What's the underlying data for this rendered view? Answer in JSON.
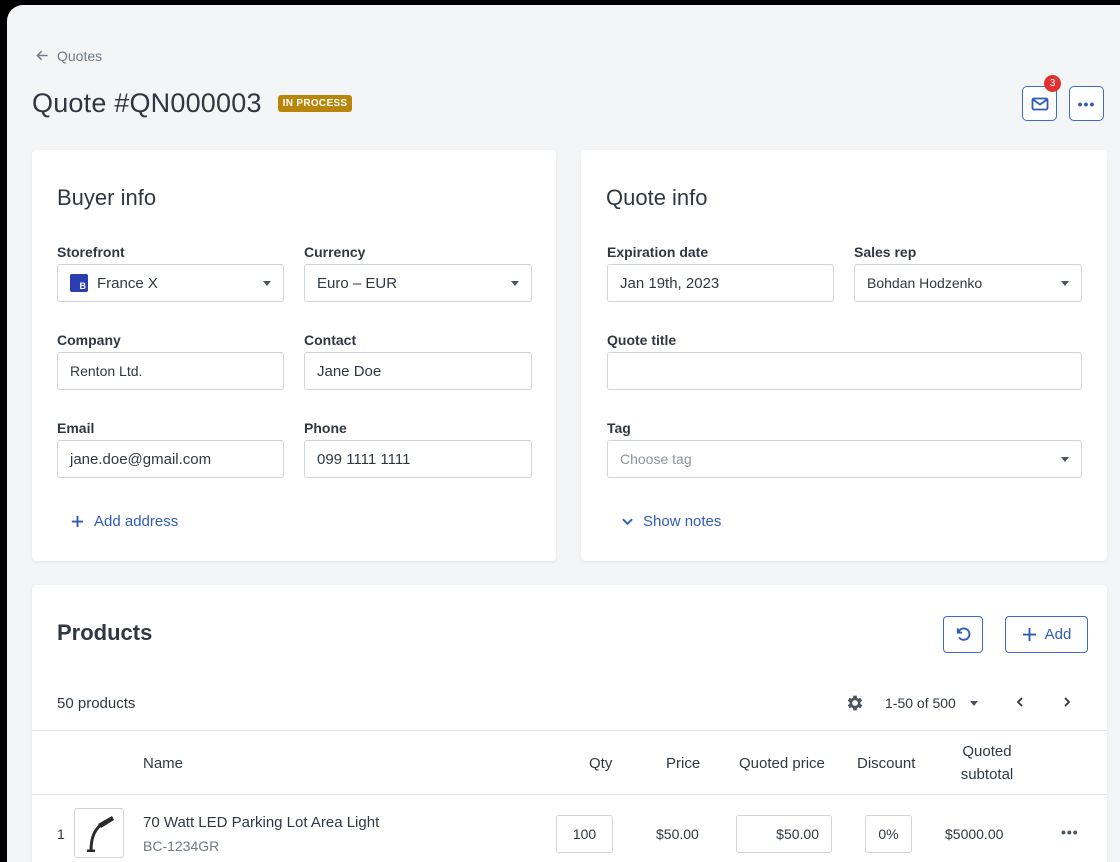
{
  "breadcrumb": {
    "back_label": "Quotes"
  },
  "header": {
    "title": "Quote #QN000003",
    "status": "IN PROCESS",
    "notification_count": "3",
    "more_label": "•••"
  },
  "buyer": {
    "title": "Buyer info",
    "storefront": {
      "label": "Storefront",
      "value": "France X",
      "icon_letter": "B"
    },
    "currency": {
      "label": "Currency",
      "value": "Euro – EUR"
    },
    "company": {
      "label": "Company",
      "value": "Renton Ltd."
    },
    "contact": {
      "label": "Contact",
      "value": "Jane Doe"
    },
    "email": {
      "label": "Email",
      "value": "jane.doe@gmail.com"
    },
    "phone": {
      "label": "Phone",
      "value": "099 1111 1111"
    },
    "add_address": "Add address"
  },
  "quote": {
    "title": "Quote info",
    "expiration": {
      "label": "Expiration date",
      "value": "Jan 19th, 2023"
    },
    "sales_rep": {
      "label": "Sales rep",
      "value": "Bohdan Hodzenko"
    },
    "quote_title": {
      "label": "Quote title",
      "value": ""
    },
    "tag": {
      "label": "Tag",
      "placeholder": "Choose tag"
    },
    "show_notes": "Show notes"
  },
  "products": {
    "title": "Products",
    "add_label": "Add",
    "count": "50 products",
    "pagination": "1-50 of 500",
    "columns": {
      "name": "Name",
      "qty": "Qty",
      "price": "Price",
      "quoted_price": "Quoted price",
      "discount": "Discount",
      "quoted_subtotal_1": "Quoted",
      "quoted_subtotal_2": "subtotal"
    },
    "rows": [
      {
        "index": "1",
        "name": "70 Watt LED Parking Lot Area Light",
        "sku": "BC-1234GR",
        "qty": "100",
        "price": "$50.00",
        "quoted_price": "$50.00",
        "discount": "0%",
        "subtotal": "$5000.00",
        "more": "•••"
      }
    ]
  },
  "colors": {
    "accent": "#2e5cb8",
    "badge": "#b8860b",
    "notification": "#e03131"
  }
}
